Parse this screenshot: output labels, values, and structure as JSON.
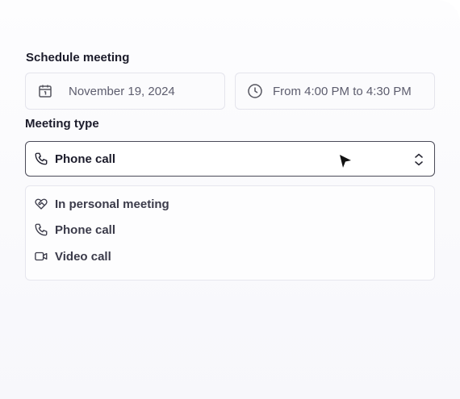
{
  "section_title": "Schedule meeting",
  "date_field": {
    "value": "November 19, 2024",
    "icon": "calendar-icon"
  },
  "time_field": {
    "value": "From 4:00 PM to 4:30 PM",
    "icon": "clock-icon"
  },
  "meeting_type": {
    "label": "Meeting type",
    "selected": "Phone call",
    "options": [
      {
        "label": "In personal meeting",
        "icon": "handshake-icon"
      },
      {
        "label": "Phone call",
        "icon": "phone-icon"
      },
      {
        "label": "Video call",
        "icon": "video-camera-icon"
      }
    ]
  }
}
